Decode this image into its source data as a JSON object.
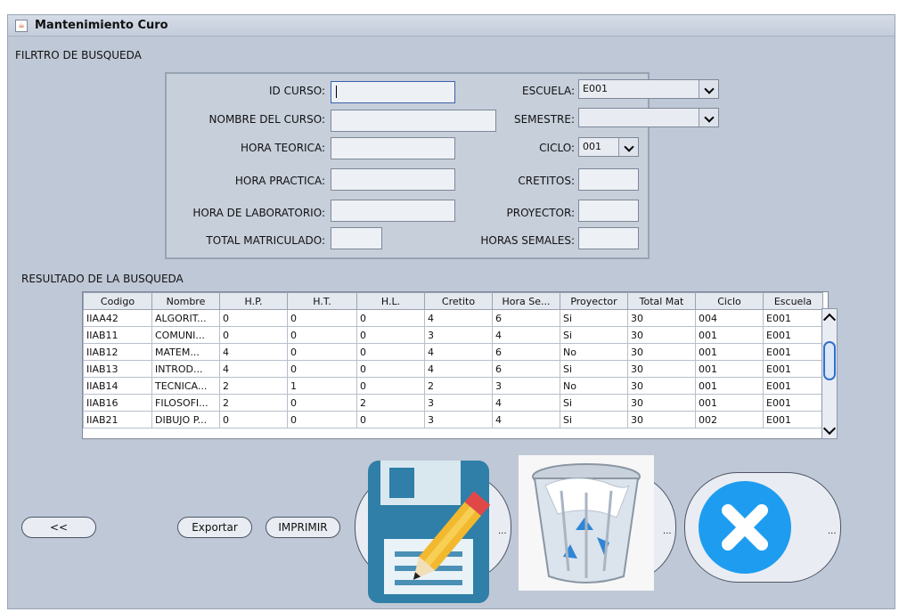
{
  "window": {
    "title": "Mantenimiento Curo",
    "icon": "java-icon"
  },
  "filter": {
    "section_label": "FILRTRO DE BUSQUEDA",
    "id_curso_label": "ID CURSO:",
    "id_curso_value": "",
    "nombre_label": "NOMBRE DEL CURSO:",
    "nombre_value": "",
    "hora_teorica_label": "HORA TEORICA:",
    "hora_teorica_value": "",
    "hora_practica_label": "HORA PRACTICA:",
    "hora_practica_value": "",
    "hora_lab_label": "HORA DE LABORATORIO:",
    "hora_lab_value": "",
    "total_matriculado_label": "TOTAL MATRICULADO:",
    "total_matriculado_value": "",
    "escuela_label": "ESCUELA:",
    "escuela_value": "E001",
    "semestre_label": "SEMESTRE:",
    "semestre_value": "",
    "ciclo_label": "CICLO:",
    "ciclo_value": "001",
    "cretitos_label": "CRETITOS:",
    "cretitos_value": "",
    "proyector_label": "PROYECTOR:",
    "proyector_value": "",
    "horas_semales_label": "HORAS SEMALES:",
    "horas_semales_value": ""
  },
  "results": {
    "section_label": "RESULTADO DE LA BUSQUEDA",
    "columns": [
      "Codigo",
      "Nombre",
      "H.P.",
      "H.T.",
      "H.L.",
      "Cretito",
      "Hora Se...",
      "Proyector",
      "Total Mat",
      "Ciclo",
      "Escuela"
    ],
    "rows": [
      [
        "IIAA42",
        "ALGORIT...",
        "0",
        "0",
        "0",
        "4",
        "6",
        "Si",
        "30",
        "004",
        "E001"
      ],
      [
        "IIAB11",
        "COMUNI...",
        "0",
        "0",
        "0",
        "3",
        "4",
        "Si",
        "30",
        "001",
        "E001"
      ],
      [
        "IIAB12",
        "MATEM...",
        "4",
        "0",
        "0",
        "4",
        "6",
        "No",
        "30",
        "001",
        "E001"
      ],
      [
        "IIAB13",
        "INTROD...",
        "4",
        "0",
        "0",
        "4",
        "6",
        "Si",
        "30",
        "001",
        "E001"
      ],
      [
        "IIAB14",
        "TECNICA...",
        "2",
        "1",
        "0",
        "2",
        "3",
        "No",
        "30",
        "001",
        "E001"
      ],
      [
        "IIAB16",
        "FILOSOFI...",
        "2",
        "0",
        "2",
        "3",
        "4",
        "Si",
        "30",
        "001",
        "E001"
      ],
      [
        "IIAB21",
        "DIBUJO P...",
        "0",
        "0",
        "0",
        "3",
        "4",
        "Si",
        "30",
        "002",
        "E001"
      ]
    ]
  },
  "actions": {
    "back_label": "<<",
    "exportar_label": "Exportar",
    "imprimir_label": "IMPRIMIR",
    "more_label": "..."
  },
  "colors": {
    "window_bg": "#bfc8d6",
    "save_icon_blue": "#2f7fa8",
    "close_icon_blue": "#1e9df0"
  },
  "icons": [
    "save-edit-icon",
    "recycle-bin-icon",
    "close-x-icon"
  ]
}
